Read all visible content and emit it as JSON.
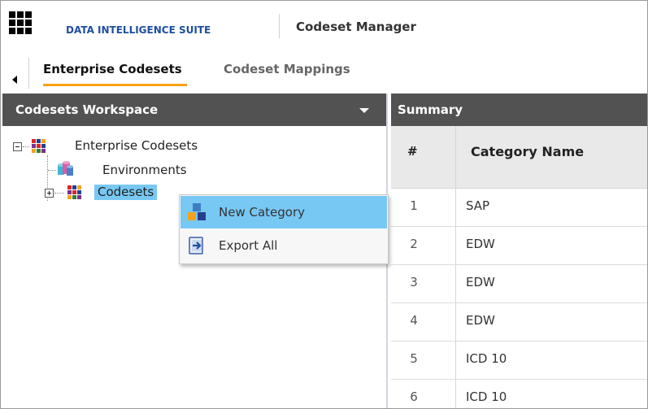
{
  "header": {
    "brand": "DATA INTELLIGENCE SUITE",
    "module": "Codeset Manager"
  },
  "tabs": [
    {
      "label": "Enterprise Codesets",
      "active": true
    },
    {
      "label": "Codeset Mappings",
      "active": false
    }
  ],
  "workspace": {
    "title": "Codesets Workspace",
    "tree": {
      "root": {
        "label": "Enterprise Codesets",
        "expanded": true
      },
      "environments": {
        "label": "Environments"
      },
      "codesets": {
        "label": "Codesets",
        "expanded": false,
        "selected": true
      }
    }
  },
  "context_menu": {
    "items": [
      {
        "label": "New Category",
        "icon": "new-category-icon",
        "highlighted": true
      },
      {
        "label": "Export All",
        "icon": "export-icon",
        "highlighted": false
      }
    ]
  },
  "summary": {
    "title": "Summary",
    "columns": [
      "#",
      "Category Name"
    ],
    "rows": [
      {
        "num": "1",
        "name": "SAP"
      },
      {
        "num": "2",
        "name": "EDW"
      },
      {
        "num": "3",
        "name": "EDW"
      },
      {
        "num": "4",
        "name": "EDW"
      },
      {
        "num": "5",
        "name": "ICD 10"
      },
      {
        "num": "6",
        "name": "ICD 10"
      }
    ]
  },
  "colors": {
    "accent_tab": "#f7a11a",
    "brand": "#1d4fa0",
    "panel_header": "#525252",
    "selection": "#78c8f4"
  }
}
